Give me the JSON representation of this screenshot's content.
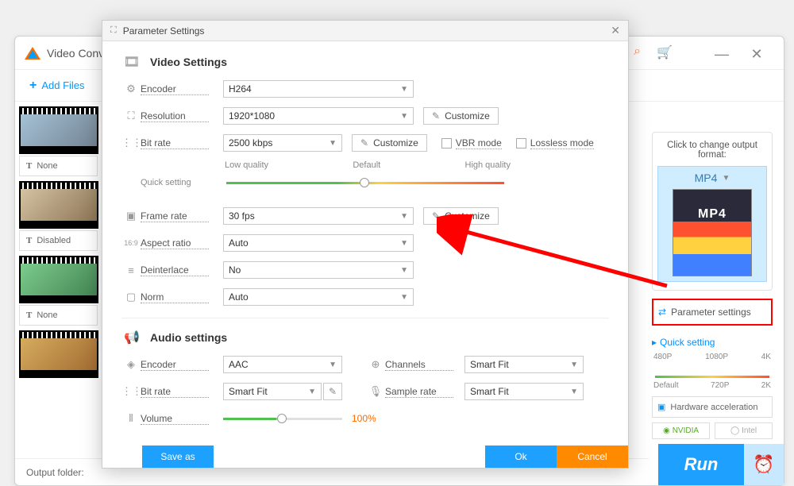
{
  "app": {
    "title": "Video Conv"
  },
  "toolbar": {
    "add_files": "Add Files"
  },
  "thumbs": [
    "None",
    "Disabled",
    "None"
  ],
  "bottom": {
    "output_folder": "Output folder:"
  },
  "right": {
    "title": "Click to change output format:",
    "format": "MP4",
    "param_settings": "Parameter settings",
    "quick": "Quick setting",
    "res_top": [
      "480P",
      "1080P",
      "4K"
    ],
    "res_bot": [
      "Default",
      "720P",
      "2K"
    ],
    "hw": "Hardware acceleration",
    "nvidia": "NVIDIA",
    "intel": "Intel",
    "run": "Run"
  },
  "dialog": {
    "title": "Parameter Settings",
    "video_section": "Video Settings",
    "audio_section": "Audio settings",
    "encoder": "Encoder",
    "resolution": "Resolution",
    "bitrate": "Bit rate",
    "quick_setting": "Quick setting",
    "low_q": "Low quality",
    "default_q": "Default",
    "high_q": "High quality",
    "framerate": "Frame rate",
    "aspect": "Aspect ratio",
    "deinterlace": "Deinterlace",
    "norm": "Norm",
    "channels": "Channels",
    "samplerate": "Sample rate",
    "volume": "Volume",
    "customize": "Customize",
    "vbr": "VBR mode",
    "lossless": "Lossless mode",
    "volume_pct": "100%",
    "vals": {
      "v_encoder": "H264",
      "v_resolution": "1920*1080",
      "v_bitrate": "2500 kbps",
      "v_framerate": "30 fps",
      "v_aspect": "Auto",
      "v_deinterlace": "No",
      "v_norm": "Auto",
      "a_encoder": "AAC",
      "a_bitrate": "Smart Fit",
      "a_channels": "Smart Fit",
      "a_samplerate": "Smart Fit"
    },
    "save_as": "Save as",
    "ok": "Ok",
    "cancel": "Cancel"
  }
}
